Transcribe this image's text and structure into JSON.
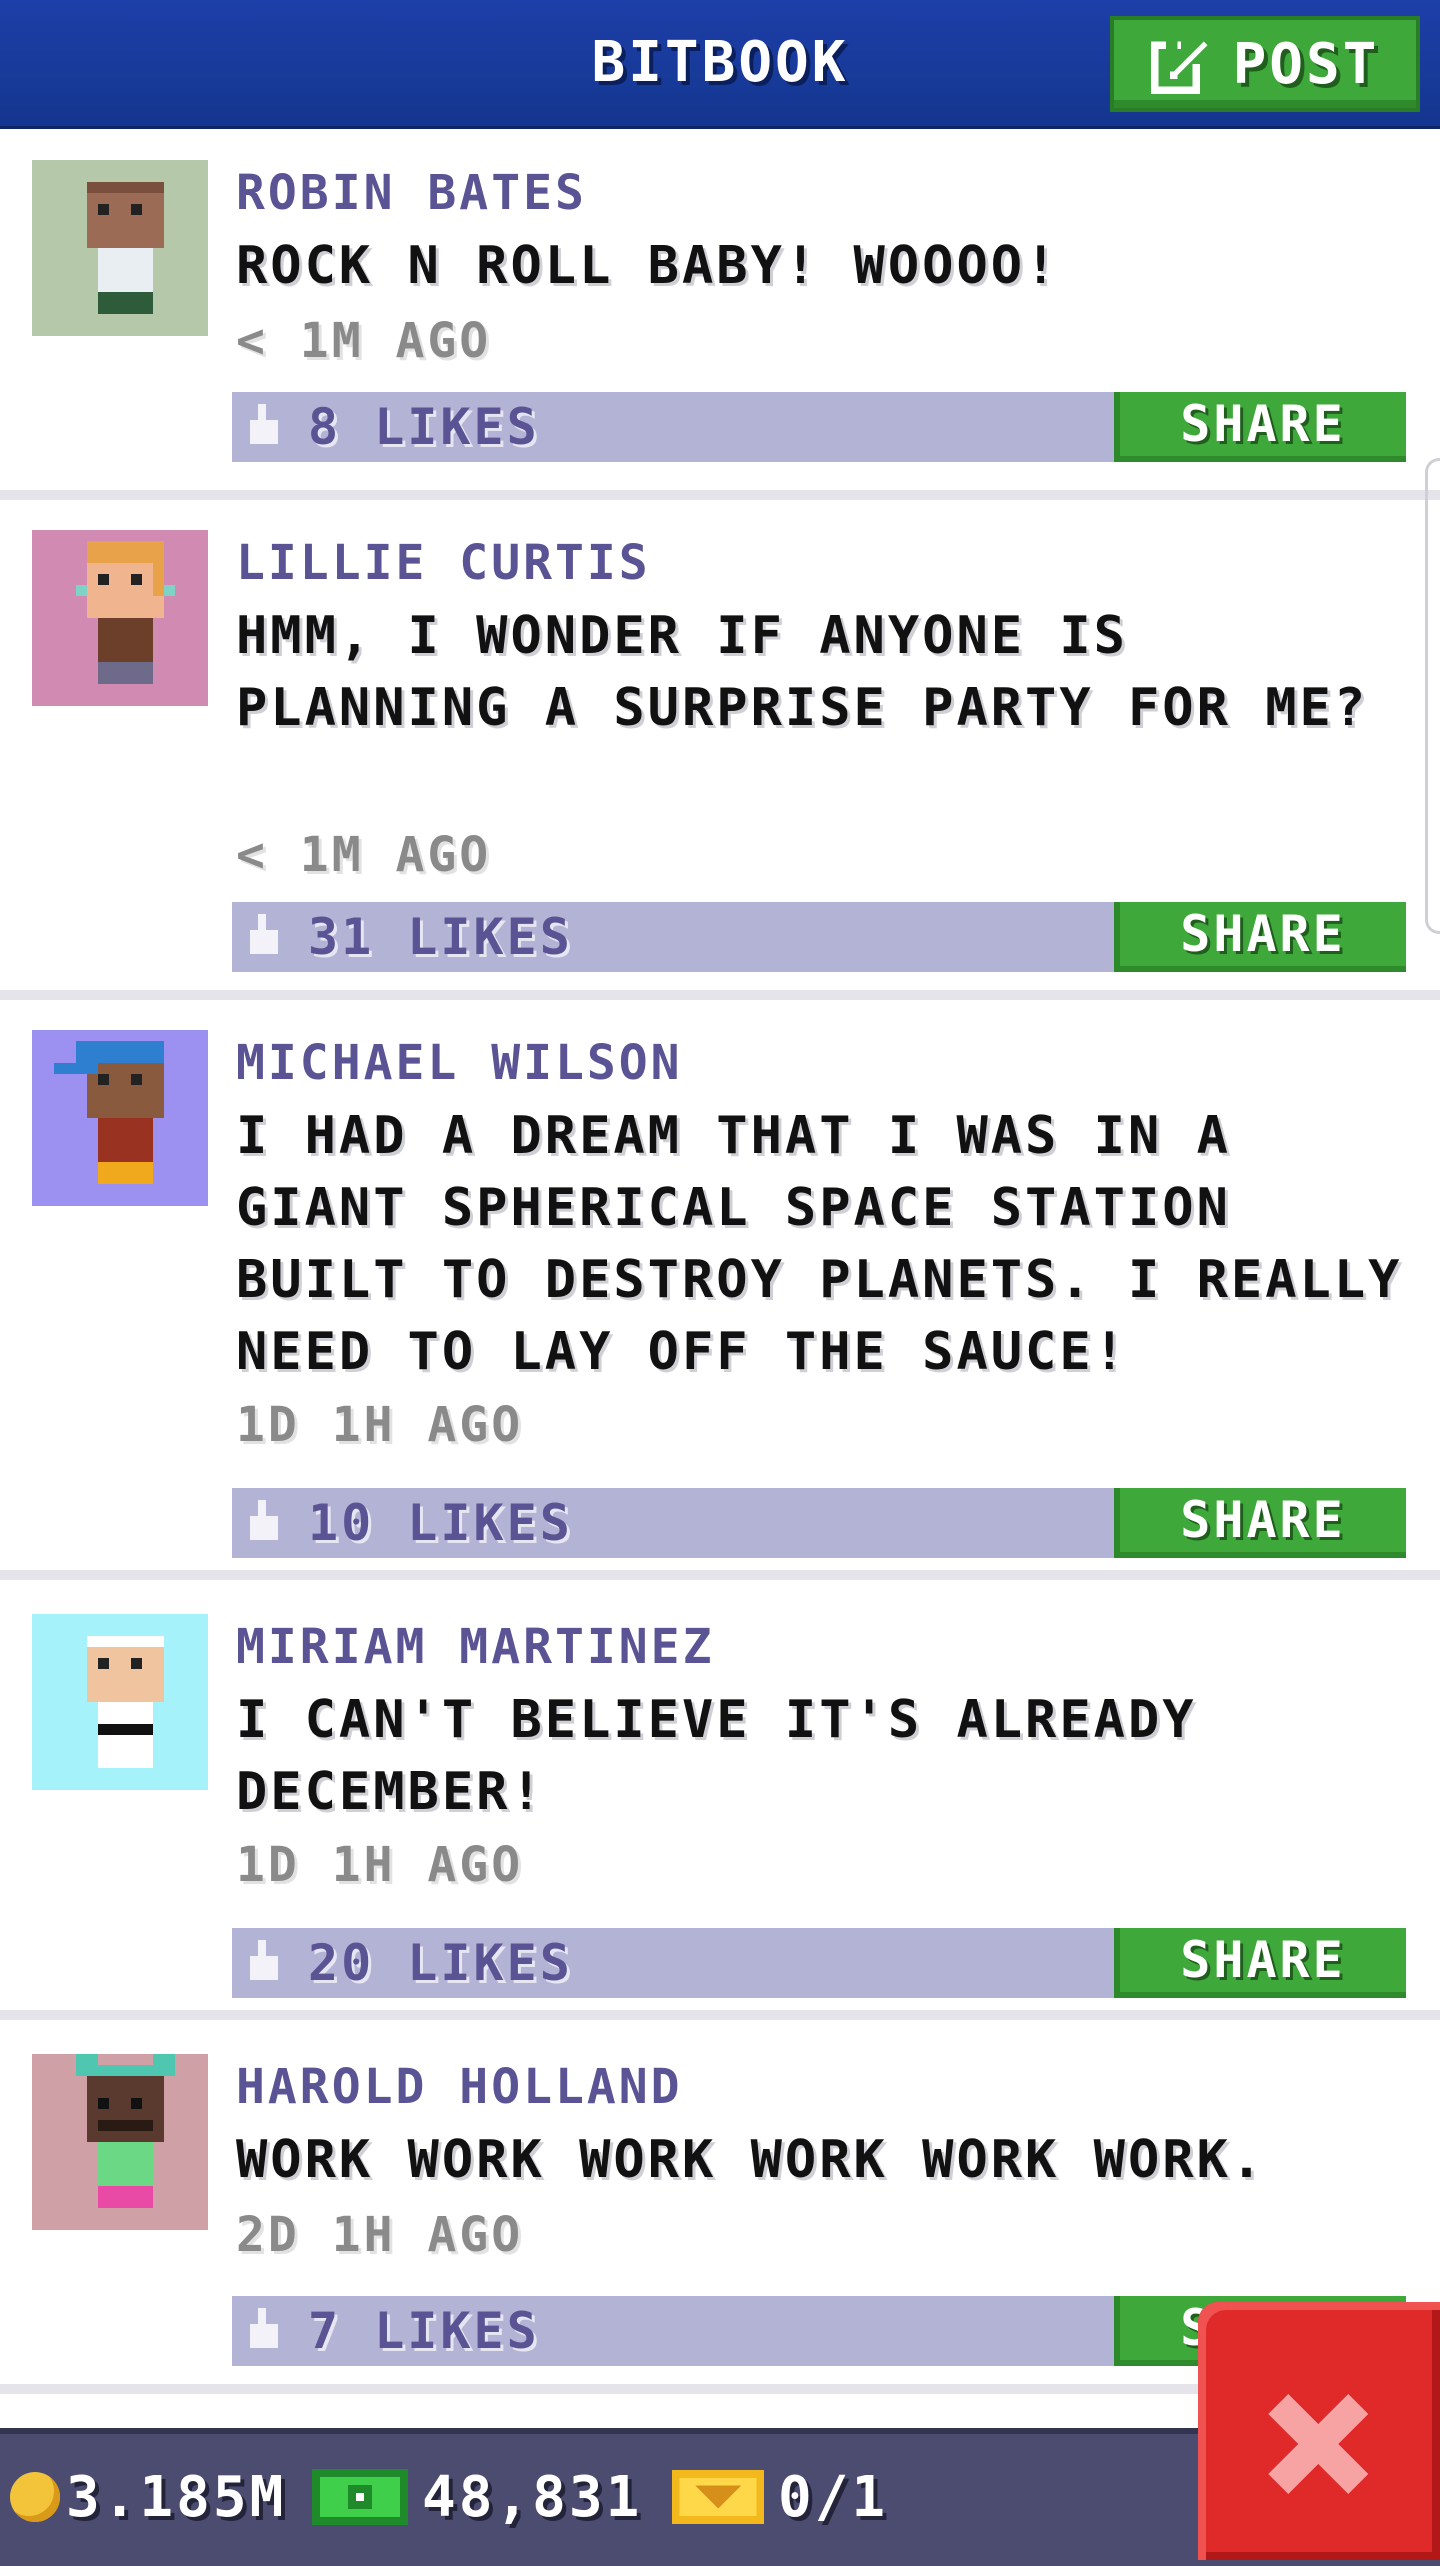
{
  "header": {
    "title": "BITBOOK",
    "post_label": "POST"
  },
  "posts": [
    {
      "name": "ROBIN BATES",
      "message": "ROCK N ROLL BABY! WOOOO!",
      "time": "< 1M AGO",
      "likes": "8 LIKES",
      "share_label": "SHARE",
      "avatar_bg": "#b5c8a9"
    },
    {
      "name": "LILLIE CURTIS",
      "message": "HMM, I WONDER IF ANYONE IS PLANNING A SURPRISE PARTY FOR ME?",
      "time": "< 1M AGO",
      "likes": "31 LIKES",
      "share_label": "SHARE",
      "avatar_bg": "#d18ab2"
    },
    {
      "name": "MICHAEL WILSON",
      "message": "I HAD A DREAM THAT I WAS IN A GIANT SPHERICAL SPACE STATION BUILT TO DESTROY PLANETS. I REALLY NEED TO LAY OFF THE SAUCE!",
      "time": "1D 1H AGO",
      "likes": "10 LIKES",
      "share_label": "SHARE",
      "avatar_bg": "#9c91f0"
    },
    {
      "name": "MIRIAM MARTINEZ",
      "message": "I CAN'T BELIEVE IT'S ALREADY DECEMBER!",
      "time": "1D 1H AGO",
      "likes": "20 LIKES",
      "share_label": "SHARE",
      "avatar_bg": "#a6f2fa"
    },
    {
      "name": "HAROLD HOLLAND",
      "message": "WORK WORK WORK WORK WORK WORK.",
      "time": "2D 1H AGO",
      "likes": "7 LIKES",
      "share_label": "SHARE",
      "avatar_bg": "#cfa0a6"
    }
  ],
  "footer": {
    "coins": "3.185M",
    "bux": "48,831",
    "tickets": "0/1"
  },
  "icons": {
    "post": "edit-icon",
    "like": "thumbs-up-icon",
    "coin": "coin-icon",
    "cash": "cash-icon",
    "ticket": "ticket-icon",
    "close": "close-icon"
  },
  "colors": {
    "header": "#1d3fa8",
    "accent_green": "#3fa83a",
    "likes_bar": "#b3b4d5",
    "name_text": "#5a5494",
    "close_red": "#e02a2a",
    "footer": "#4b4c70"
  }
}
